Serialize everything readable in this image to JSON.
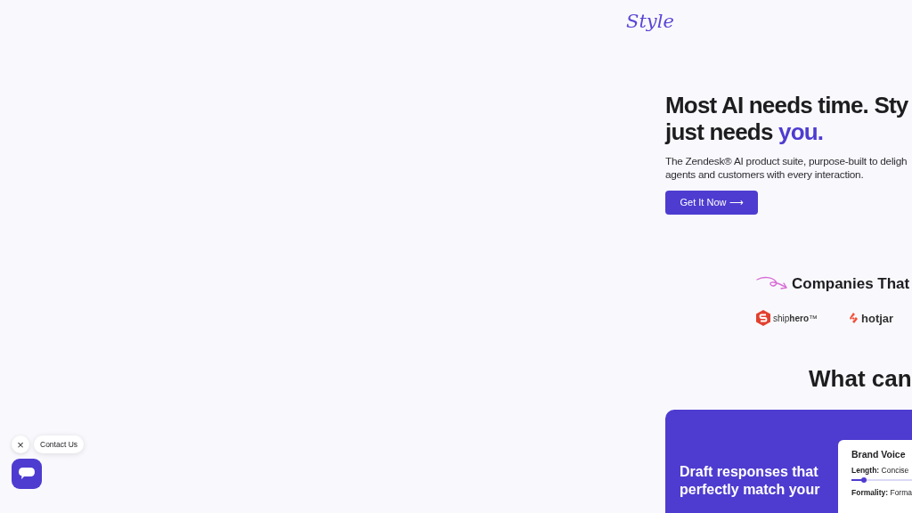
{
  "logo": {
    "text": "Style"
  },
  "hero": {
    "title_lines": [
      "Most AI needs time. Sty",
      "just needs"
    ],
    "highlight": "you.",
    "subtitle_lines": [
      "The Zendesk® AI product suite, purpose-built to deligh",
      "agents and customers with every interaction."
    ],
    "button": "Get It Now ⟶"
  },
  "companies": {
    "title": "Companies That",
    "logos": [
      {
        "kind": "shiphero",
        "text": "ship**hero**™"
      },
      {
        "kind": "hotjar",
        "text": "hotjar"
      }
    ]
  },
  "features": {
    "title": "What can",
    "card": {
      "heading_lines": [
        "Draft responses that",
        "perfectly match your"
      ],
      "panel": {
        "title": "Brand Voice",
        "settings": [
          {
            "label": "Length:",
            "value": "Concise"
          },
          {
            "label": "Formality:",
            "value": "Forma"
          }
        ]
      }
    }
  },
  "chat": {
    "label": "Contact Us",
    "close": "×"
  }
}
